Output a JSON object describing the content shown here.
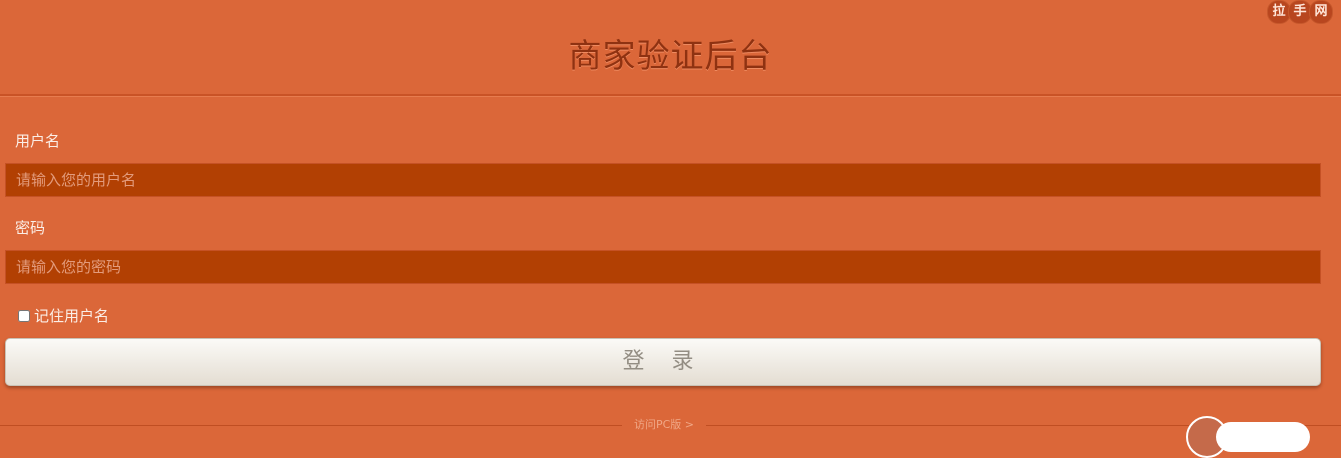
{
  "header": {
    "title": "商家验证后台"
  },
  "watermark": {
    "chars": [
      "拉",
      "手",
      "网"
    ]
  },
  "form": {
    "username_label": "用户名",
    "username_placeholder": "请输入您的用户名",
    "password_label": "密码",
    "password_placeholder": "请输入您的密码",
    "remember_label": "记住用户名",
    "remember_checked": false,
    "login_label": "登 录"
  },
  "footer": {
    "pc_link": "访问PC版 >"
  },
  "colors": {
    "background": "#db6739",
    "input_background": "#b24003",
    "title_color": "#8f3211"
  }
}
